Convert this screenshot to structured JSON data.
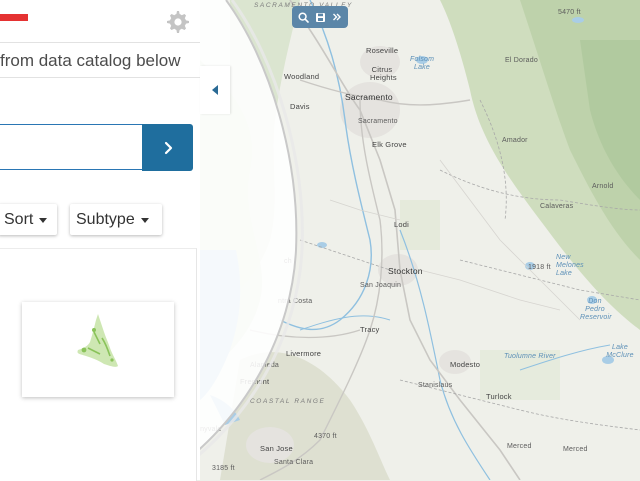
{
  "panel": {
    "subtitle": "from data catalog below",
    "search": {
      "value": "",
      "placeholder": ""
    },
    "sort_label": "Sort",
    "subtype_label": "Subtype"
  },
  "map": {
    "labels": {
      "sacramento_valley": "SACRAMENTO VALLEY",
      "roseville": "Roseville",
      "citrus_heights": "Citrus Heights",
      "folsom_lake": "Folsom Lake",
      "el_dorado": "El Dorado",
      "woodland": "Woodland",
      "sacramento": "Sacramento",
      "davis": "Davis",
      "sacramento_small": "Sacramento",
      "elk_grove": "Elk Grove",
      "amador": "Amador",
      "arnold": "Arnold",
      "calaveras": "Calaveras",
      "lodi": "Lodi",
      "stockton": "Stockton",
      "san_joaquin": "San Joaquin",
      "contra_costa": "ntra Costa",
      "tracy": "Tracy",
      "livermore": "Livermore",
      "fremont": "Fremont",
      "alameda": "Alameda",
      "modesto": "Modesto",
      "stanislaus": "Stanislaus",
      "turlock": "Turlock",
      "coastal_range": "COASTAL RANGE",
      "san_jose": "San Jose",
      "santa_clara": "Santa Clara",
      "sunnyvale": "nnyvale",
      "merced": "Merced",
      "merced2": "Merced",
      "new_melones": "New Melones Lake",
      "don_pedro": "Don Pedro Reservoir",
      "mcclure": "Lake McClure",
      "tuolumne": "Tuolumne River",
      "elev_1": "5470 ft",
      "elev_2": "1918 ft",
      "elev_3": "4370 ft",
      "elev_4": "3185 ft",
      "ch_label": "ch"
    }
  },
  "colors": {
    "accent": "#1f6e9e",
    "brand_red": "#e53232",
    "toolbar": "#5b86a8"
  },
  "icons": {
    "settings": "gear-icon",
    "search_submit": "chevron-right-icon",
    "collapse": "triangle-left-icon",
    "toolbar_search": "search-icon",
    "toolbar_save": "save-icon",
    "toolbar_more": "double-chevron-icon"
  }
}
